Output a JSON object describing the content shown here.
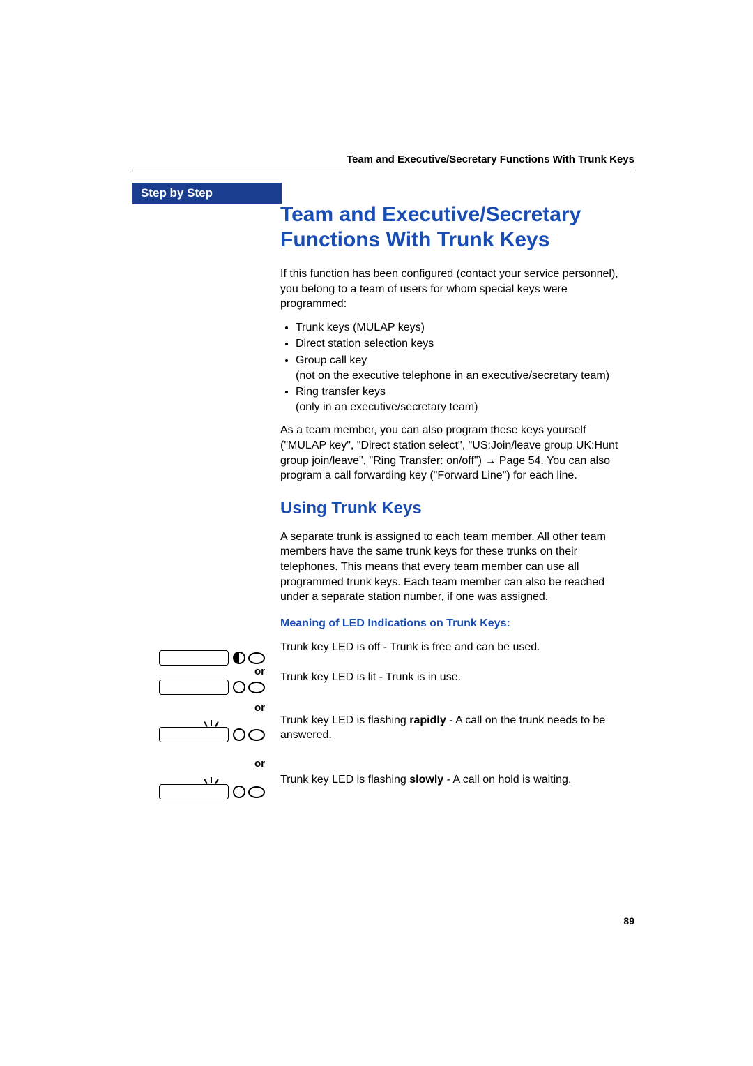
{
  "header": {
    "running_title": "Team and Executive/Secretary Functions With Trunk Keys"
  },
  "sidebar": {
    "label": "Step by Step",
    "or_label": "or"
  },
  "main": {
    "h1": "Team and Executive/Secretary Functions With Trunk Keys",
    "intro": "If this function has been configured (contact your service personnel), you belong to a team of users for whom special keys were programmed:",
    "bullets": [
      "Trunk keys (MULAP keys)",
      "Direct station selection keys",
      "Group call key\n(not on the executive telephone in an executive/secretary team)",
      "Ring transfer keys\n(only in an executive/secretary team)"
    ],
    "para2_a": "As a team member, you can also program these keys yourself (\"MULAP key\", \"Direct station select\", \"US:Join/leave group UK:Hunt group join/leave\", \"Ring Transfer: on/off\") ",
    "para2_arrow": "→",
    "para2_pageref": " Page 54",
    "para2_b": ". You can also program a call forwarding key (\"Forward Line\") for each line.",
    "h2": "Using Trunk Keys",
    "para3": "A separate trunk is assigned to each team member. All other team members have the same trunk keys for these trunks on their telephones. This means that every team member can use all programmed trunk keys. Each team member can also be reached under a separate station number, if one was assigned.",
    "h3": "Meaning of LED Indications on Trunk Keys:",
    "led_off": "Trunk key LED is off - Trunk is free and can be used.",
    "led_lit": "Trunk key LED is lit - Trunk is in use.",
    "led_rapid_a": "Trunk key LED is flashing ",
    "led_rapid_bold": "rapidly",
    "led_rapid_b": " - A call on the trunk needs to be answered.",
    "led_slow_a": "Trunk key LED is flashing ",
    "led_slow_bold": "slowly",
    "led_slow_b": " - A call on hold is waiting."
  },
  "footer": {
    "page_number": "89"
  }
}
